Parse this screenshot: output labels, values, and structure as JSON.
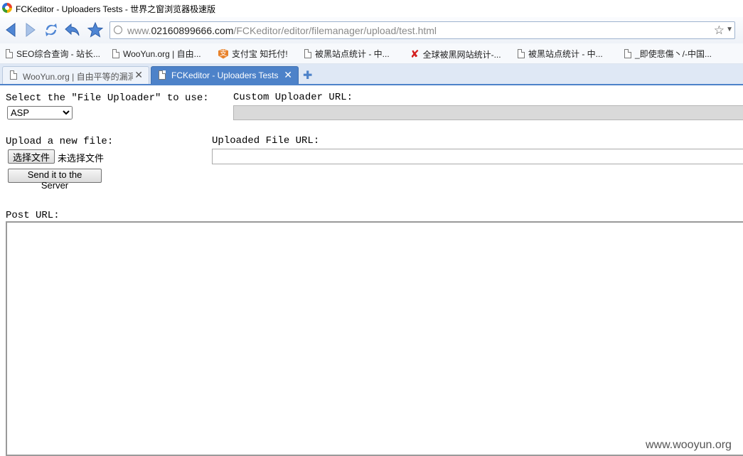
{
  "window": {
    "title": "FCKeditor - Uploaders Tests - 世界之窗浏览器极速版"
  },
  "addressbar": {
    "url_prefix": "www.",
    "url_domain": "02160899666.com",
    "url_path": "/FCKeditor/editor/filemanager/upload/test.html"
  },
  "bookmarks": [
    {
      "label": "SEO综合查询 - 站长...",
      "icon": "page-icon"
    },
    {
      "label": "WooYun.org | 自由...",
      "icon": "page-icon"
    },
    {
      "label": "支付宝 知托付!",
      "icon": "alipay-icon"
    },
    {
      "label": "被黑站点统计 - 中...",
      "icon": "page-icon"
    },
    {
      "label": "全球被黑网站统计-...",
      "icon": "red-x-icon"
    },
    {
      "label": "被黑站点统计 - 中...",
      "icon": "page-icon"
    },
    {
      "label": "_即使悲傷丶/-中国...",
      "icon": "page-icon"
    }
  ],
  "tabs": [
    {
      "label": "WooYun.org | 自由平等的漏洞",
      "active": false
    },
    {
      "label": "FCKeditor - Uploaders Tests",
      "active": true
    }
  ],
  "form": {
    "select_label": "Select the \"File Uploader\" to use:",
    "uploader_selected": "ASP",
    "custom_url_label": "Custom Uploader URL:",
    "upload_label": "Upload a new file:",
    "choose_file_button": "选择文件",
    "no_file_text": "未选择文件",
    "send_button": "Send it to the Server",
    "uploaded_url_label": "Uploaded File URL:",
    "post_url_label": "Post URL:"
  },
  "watermark": "www.wooyun.org",
  "colors": {
    "tab_active": "#4d82c9",
    "nav_icon": "#4f86d4"
  }
}
